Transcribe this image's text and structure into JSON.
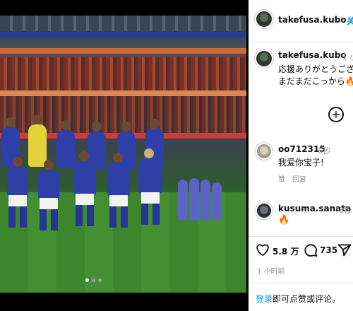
{
  "post": {
    "image_alt": "Japan national football team group photo",
    "carousel_dots": 3,
    "active_dot": 1
  },
  "header": {
    "username": "takefusa.kubo",
    "separator": "·",
    "follow": "关"
  },
  "caption": {
    "username": "takefusa.kubo",
    "time": "1 小",
    "line1": "応援ありがとうござい",
    "line2": "まだまだこっから🔥🔥"
  },
  "comments": [
    {
      "username": "oo712315",
      "time": "6秒",
      "text": "我爱你宝子!",
      "like_label": "赞",
      "reply_label": "回复"
    },
    {
      "username": "kusuma.sanata",
      "time": "8秒",
      "text": "🔥"
    }
  ],
  "actions": {
    "like_count": "5.8 万",
    "comment_count": "735",
    "time_ago": "1 小时前"
  },
  "footer": {
    "login_link": "登录",
    "login_text": "即可点赞或评论。"
  },
  "colors": {
    "link": "#0095f6",
    "muted": "#8e8e8e",
    "text": "#111111"
  }
}
